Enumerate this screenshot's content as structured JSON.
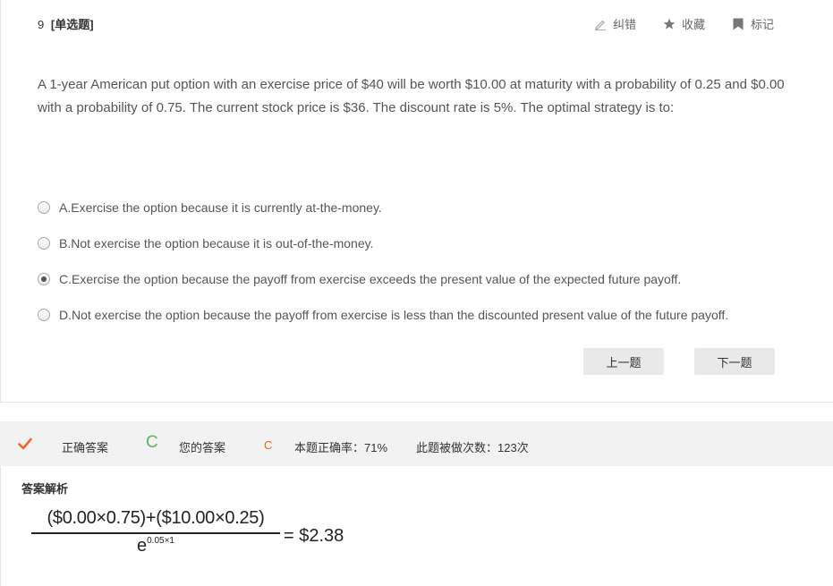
{
  "question": {
    "number": "9",
    "type": "[单选题]",
    "text": "A 1-year American put option with an exercise price of $40 will be worth $10.00 at maturity with a probability of 0.25 and $0.00 with a probability of 0.75. The current stock price is $36. The discount rate is 5%. The optimal strategy is to:",
    "options": [
      {
        "label": "A.Exercise the option because it is currently at-the-money.",
        "selected": false
      },
      {
        "label": "B.Not exercise the option because it is out-of-the-money.",
        "selected": false
      },
      {
        "label": "C.Exercise the option because the payoff from exercise exceeds the present value of the expected future payoff.",
        "selected": true
      },
      {
        "label": "D.Not exercise the option because the payoff from exercise is less than the discounted present value of the future payoff.",
        "selected": false
      }
    ]
  },
  "toolbar": {
    "correct_error": "纠错",
    "favorite": "收藏",
    "mark": "标记",
    "icons": [
      "pencil-icon",
      "star-icon",
      "bookmark-icon"
    ]
  },
  "navigation": {
    "prev": "上一题",
    "next": "下一题"
  },
  "answer_bar": {
    "correct_label": "正确答案",
    "correct_value": "C",
    "your_label": "您的答案",
    "your_value": "C",
    "accuracy": "本题正确率：71%",
    "times_done": "此题被做次数：123次",
    "colors": {
      "correct": "#5cb85c",
      "yours": "#f26522",
      "check": "#f26522"
    }
  },
  "analysis": {
    "title": "答案解析",
    "formula_numerator": "($0.00×0.75)+($10.00×0.25)",
    "formula_denominator_base": "e",
    "formula_denominator_exp": "0.05×1",
    "formula_result": "= $2.38"
  }
}
